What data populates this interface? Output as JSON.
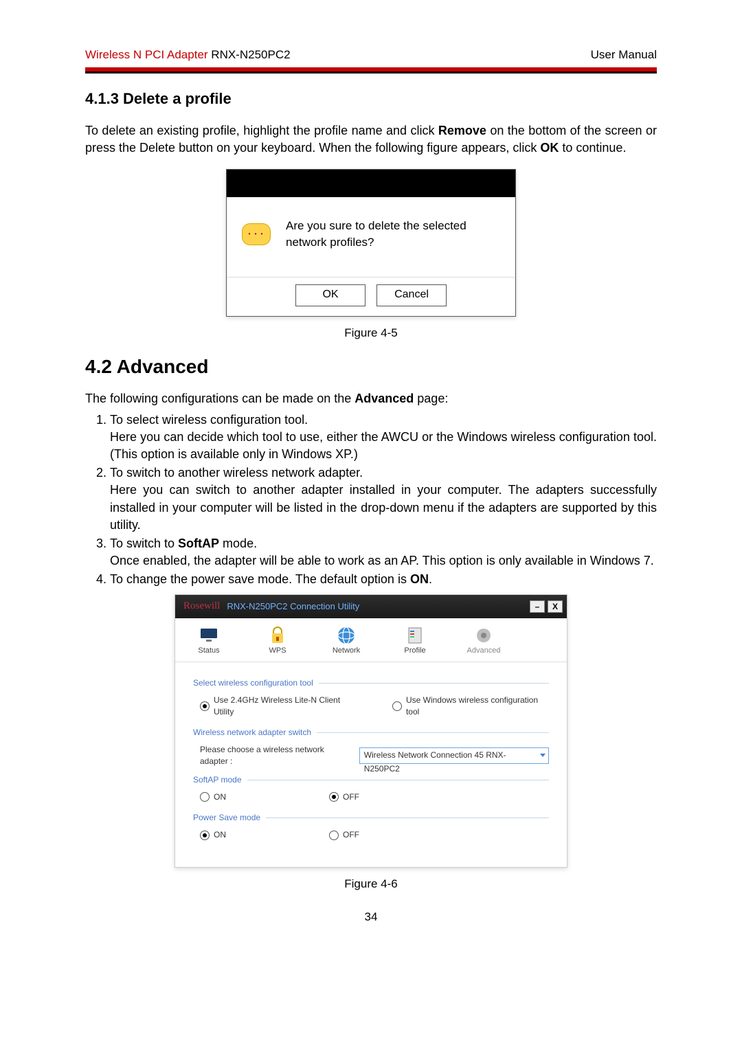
{
  "header": {
    "left_red": "Wireless N PCI Adapter",
    "left_black": " RNX-N250PC2",
    "right": "User Manual"
  },
  "section_413": {
    "heading": "4.1.3 Delete a profile",
    "text_pre": "To delete an existing profile, highlight the profile name and click ",
    "bold1": "Remove",
    "text_mid": " on the bottom of the screen or press the Delete button on your keyboard. When the following figure appears, click ",
    "bold2": "OK",
    "text_post": " to continue."
  },
  "dialog": {
    "message": "Are you sure to delete the selected network profiles?",
    "ok": "OK",
    "cancel": "Cancel"
  },
  "fig45": "Figure 4-5",
  "section_42": {
    "heading": "4.2 Advanced",
    "intro_pre": "The following configurations can be made on the ",
    "intro_bold": "Advanced",
    "intro_post": " page:",
    "items": [
      {
        "line": "To select wireless configuration tool.",
        "body": "Here you can decide which tool to use, either the AWCU or the Windows wireless configuration tool. (This option is available only in Windows XP.)"
      },
      {
        "line_pre": "To switch to another wireless network adapter.",
        "body": "Here you can switch to another adapter installed in your computer. The adapters successfully installed in your computer will be listed in the drop-down menu if the adapters are supported by this utility."
      },
      {
        "line_pre": "To switch to ",
        "line_bold": "SoftAP",
        "line_post": " mode.",
        "body": "Once enabled, the adapter will be able to work as an AP. This option is only available in Windows 7."
      },
      {
        "line_pre": "To change the power save mode. The default option is ",
        "line_bold": "ON",
        "line_post": "."
      }
    ]
  },
  "utility": {
    "title": "RNX-N250PC2 Connection Utility",
    "tabs": [
      "Status",
      "WPS",
      "Network",
      "Profile",
      "Advanced"
    ],
    "sections": {
      "config_tool": "Select wireless configuration tool",
      "opt1": "Use 2.4GHz Wireless Lite-N Client Utility",
      "opt2": "Use Windows wireless configuration tool",
      "adapter_switch": "Wireless network adapter switch",
      "adapter_label": "Please choose a wireless network adapter :",
      "adapter_value": "Wireless Network Connection 45 RNX-N250PC2",
      "softap": "SoftAP mode",
      "on": "ON",
      "off": "OFF",
      "powersave": "Power Save mode"
    }
  },
  "fig46": "Figure 4-6",
  "page_number": "34"
}
